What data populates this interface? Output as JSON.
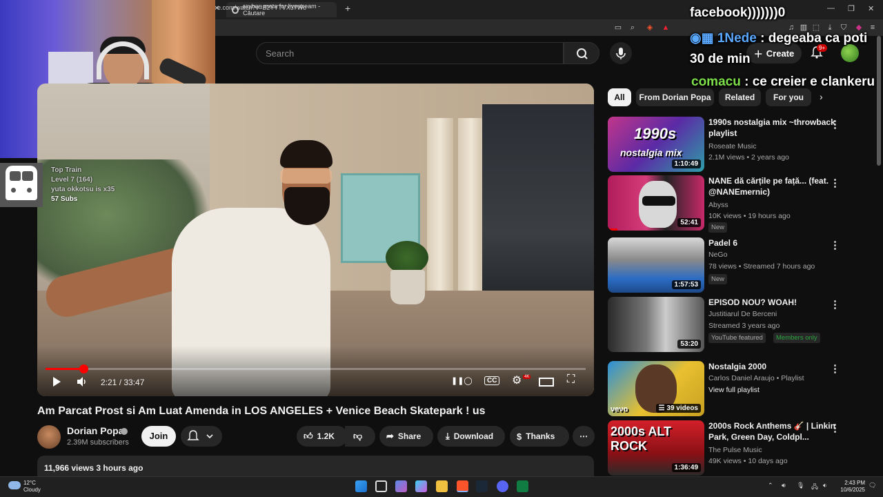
{
  "browser": {
    "tab_title": "rayban meta for livestream - Căutare",
    "tab_close": "✕",
    "new_tab": "+",
    "url": "e.com/watch?v=B2YYTVX37Wc",
    "window_controls": [
      "—",
      "❐",
      "✕"
    ]
  },
  "header": {
    "search_placeholder": "Search",
    "create_label": "Create",
    "notif_count": "9+"
  },
  "chat": [
    {
      "user": "",
      "message": "facebook)))))))0"
    },
    {
      "user": "1Nede",
      "message": " : degeaba ca poti"
    },
    {
      "user": "",
      "message": "30 de min"
    },
    {
      "user": "comacu",
      "message": " : ce creier e clankeru"
    }
  ],
  "train_overlay": {
    "line1": "Top Train",
    "line2": "Level 7 (164)",
    "line3": "yuta okkotsu is x35",
    "line4": "57 Subs"
  },
  "player": {
    "time": "2:21 / 33:47",
    "progress": 0.07,
    "hd_badge": "4K"
  },
  "video": {
    "title": "Am Parcat Prost si Am Luat Amenda in LOS ANGELES + Venice Beach Skatepark ! us",
    "channel": "Dorian Popa",
    "subscribers": "2.39M subscribers",
    "join": "Join",
    "likes": "1.2K",
    "share": "Share",
    "download": "Download",
    "thanks": "Thanks",
    "more": "⋯",
    "views_date": "11,966 views  3 hours ago"
  },
  "chips": [
    "All",
    "From Dorian Popa",
    "Related",
    "For you"
  ],
  "recommendations": [
    {
      "title": "1990s nostalgia mix ~throwback playlist",
      "channel": "Roseate Music",
      "meta": "2.1M views • 2 years ago",
      "duration": "1:10:49",
      "thumb_text1": "1990s",
      "thumb_text2": "nostalgia mix",
      "tag": ""
    },
    {
      "title": "NANE dă cărțile pe față... (feat. @NANEmernic)",
      "channel": "Abyss",
      "meta": "10K views • 19 hours ago",
      "duration": "52:41",
      "tag": "New"
    },
    {
      "title": "Padel  6",
      "channel": "NeGo",
      "meta": "78 views • Streamed 7 hours ago",
      "duration": "1:57:53",
      "tag": "New"
    },
    {
      "title": "EPISOD NOU? WOAH!",
      "channel": "Justitiarul De Berceni",
      "meta": "Streamed 3 years ago",
      "duration": "53:20",
      "tag": "YouTube featured",
      "tag2": "Members only"
    },
    {
      "title": "Nostalgia 2000",
      "channel": "Carlos Daniel Araujo • Playlist",
      "meta": "View full playlist",
      "duration": "39 videos",
      "thumb_text1": "vevo",
      "tag": ""
    },
    {
      "title": "2000s Rock Anthems 🎸 | Linkin Park, Green Day, Coldpl...",
      "channel": "The Pulse Music",
      "meta": "49K views • 10 days ago",
      "duration": "1:36:49",
      "thumb_text1": "2000s ALT ROCK",
      "tag": ""
    }
  ],
  "taskbar": {
    "temp": "12°C",
    "weather": "Cloudy",
    "time": "2:43 PM",
    "date": "10/6/2025"
  },
  "colors": {
    "background": "#0f0f0f",
    "accent_red": "#ff0000",
    "chat_user_blue": "#5aa8ff",
    "chat_user_green": "#7de04a"
  }
}
